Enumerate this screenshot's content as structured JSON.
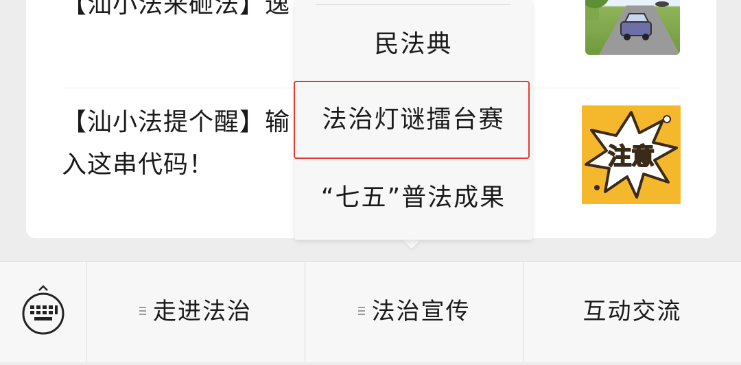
{
  "articles": [
    {
      "title": "【汕小法来砸法】逸"
    },
    {
      "title": "【汕小法提个醒】输入这串代码！",
      "thumb_label": "注意"
    }
  ],
  "submenu": {
    "items": [
      {
        "label": "民法典"
      },
      {
        "label": "法治灯谜擂台赛",
        "highlighted": true
      },
      {
        "label": "“七五”普法成果"
      }
    ]
  },
  "menubar": {
    "keyboard_icon": "keyboard-icon",
    "items": [
      {
        "label": "走进法治",
        "has_submenu": true
      },
      {
        "label": "法治宣传",
        "has_submenu": true
      },
      {
        "label": "互动交流",
        "has_submenu": false
      }
    ]
  },
  "colors": {
    "highlight_border": "#e23a2e",
    "menubar_bg": "#f7f7f7",
    "page_bg": "#ededed"
  }
}
